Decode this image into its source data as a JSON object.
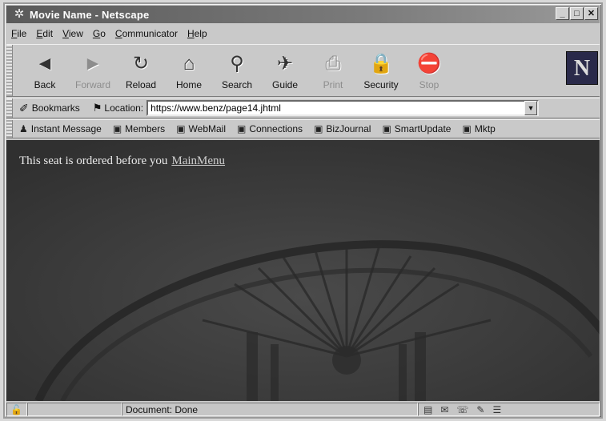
{
  "window": {
    "title": "Movie Name - Netscape"
  },
  "menu": [
    "File",
    "Edit",
    "View",
    "Go",
    "Communicator",
    "Help"
  ],
  "nav_buttons": [
    {
      "label": "Back",
      "icon": "back-arrow-icon",
      "glyph": "◄",
      "enabled": true
    },
    {
      "label": "Forward",
      "icon": "forward-arrow-icon",
      "glyph": "►",
      "enabled": false
    },
    {
      "label": "Reload",
      "icon": "reload-icon",
      "glyph": "↻",
      "enabled": true
    },
    {
      "label": "Home",
      "icon": "home-icon",
      "glyph": "⌂",
      "enabled": true
    },
    {
      "label": "Search",
      "icon": "search-icon",
      "glyph": "⚲",
      "enabled": true
    },
    {
      "label": "Guide",
      "icon": "guide-icon",
      "glyph": "✈",
      "enabled": true
    },
    {
      "label": "Print",
      "icon": "print-icon",
      "glyph": "⎙",
      "enabled": false
    },
    {
      "label": "Security",
      "icon": "lock-icon",
      "glyph": "🔒",
      "enabled": true
    },
    {
      "label": "Stop",
      "icon": "stop-icon",
      "glyph": "⛔",
      "enabled": false
    }
  ],
  "location_bar": {
    "bookmarks_label": "Bookmarks",
    "location_label": "Location:",
    "url": "https://www.benz/page14.jhtml"
  },
  "personal_toolbar": [
    {
      "label": "Instant Message",
      "glyph": "♟"
    },
    {
      "label": "Members",
      "glyph": "▣"
    },
    {
      "label": "WebMail",
      "glyph": "▣"
    },
    {
      "label": "Connections",
      "glyph": "▣"
    },
    {
      "label": "BizJournal",
      "glyph": "▣"
    },
    {
      "label": "SmartUpdate",
      "glyph": "▣"
    },
    {
      "label": "Mktp",
      "glyph": "▣"
    }
  ],
  "content": {
    "message": "This seat is ordered before you",
    "link": "MainMenu"
  },
  "status": {
    "text": "Document: Done"
  },
  "colors": {
    "content_bg": "#3d3d3d",
    "text": "#eaeaea"
  }
}
